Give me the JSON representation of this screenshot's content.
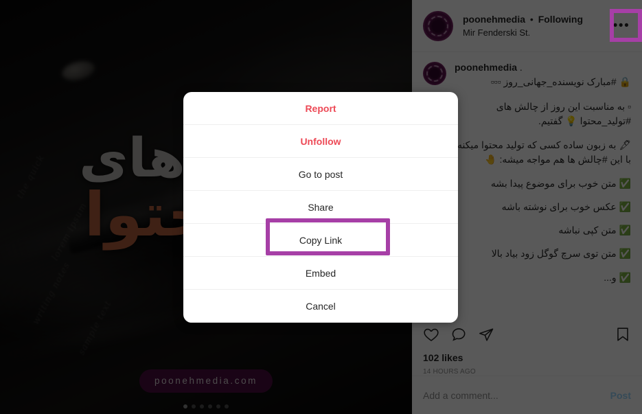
{
  "post": {
    "header": {
      "username": "poonehmedia",
      "separator": "•",
      "follow_state": "Following",
      "location": "Mir Fenderski St.",
      "more_icon": "•••"
    },
    "caption": {
      "username": "poonehmedia",
      "lead": ".",
      "line_1": "🔒 #مبارک نویسنده_جهانی_روز ▫▫▫",
      "para_1": "▫ به مناسبت این روز از چالش های #تولید_محتوا 💡 گفتیم.",
      "para_2": "🖋 به زبون ساده کسی که تولید محتوا میکنه با این #چالش ها هم مواجه میشه: 🤚",
      "list": [
        "✅ متن خوب برای موضوع پیدا بشه",
        "✅ عکس خوب برای نوشته باشه",
        "✅ متن کپی نباشه",
        "✅ متن توی سرچ گوگل زود بیاد بالا",
        "✅ و..."
      ]
    },
    "actions": {
      "like_icon": "heart-icon",
      "comment_icon": "comment-icon",
      "share_icon": "share-icon",
      "save_icon": "bookmark-icon",
      "likes": "102 likes",
      "timestamp": "14 HOURS AGO"
    },
    "comment_bar": {
      "placeholder": "Add a comment...",
      "post_label": "Post"
    }
  },
  "media": {
    "art_line_1": "های",
    "art_line_2": "محتوا",
    "watermark": "poonehmedia.com",
    "scribbles": [
      "the quick",
      "lorem ipsum",
      "writing notes",
      "sample text"
    ],
    "carousel": {
      "total": 6,
      "active_index": 0
    }
  },
  "modal": {
    "items": [
      {
        "label": "Report",
        "style": "danger"
      },
      {
        "label": "Unfollow",
        "style": "danger"
      },
      {
        "label": "Go to post",
        "style": "normal"
      },
      {
        "label": "Share",
        "style": "normal"
      },
      {
        "label": "Copy Link",
        "style": "normal"
      },
      {
        "label": "Embed",
        "style": "normal"
      },
      {
        "label": "Cancel",
        "style": "normal"
      }
    ]
  },
  "annotations": {
    "highlight_color": "#a63fa6",
    "highlighted_menu_item": "Copy Link",
    "highlighted_control": "more-options-button"
  },
  "colors": {
    "danger": "#ed4956",
    "text": "#262626",
    "muted": "#8e8e8e",
    "link": "#0095f6",
    "highlight": "#a63fa6",
    "watermark_bg": "#4b0d3f",
    "art_orange": "#b5603c"
  }
}
